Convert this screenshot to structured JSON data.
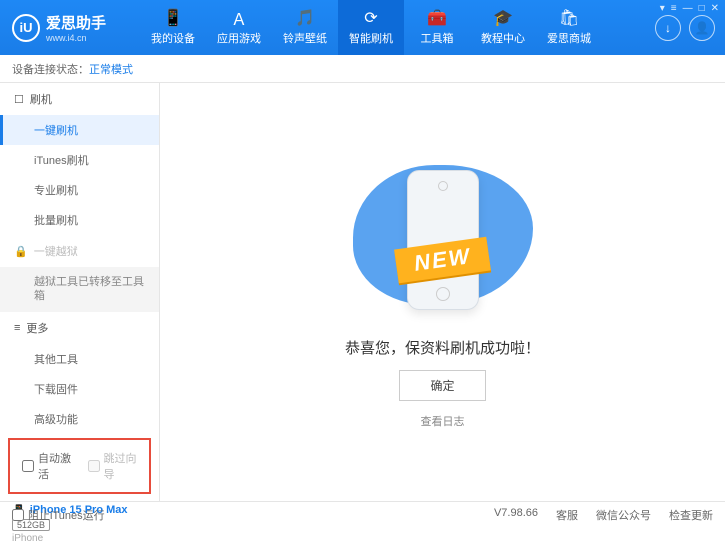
{
  "header": {
    "logo_text": "爱思助手",
    "logo_url": "www.i4.cn",
    "logo_badge": "iU",
    "nav": [
      {
        "label": "我的设备",
        "icon": "📱"
      },
      {
        "label": "应用游戏",
        "icon": "Ａ"
      },
      {
        "label": "铃声壁纸",
        "icon": "🎵"
      },
      {
        "label": "智能刷机",
        "icon": "⟳",
        "active": true
      },
      {
        "label": "工具箱",
        "icon": "🧰"
      },
      {
        "label": "教程中心",
        "icon": "🎓"
      },
      {
        "label": "爱思商城",
        "icon": "🛍"
      }
    ],
    "download_icon": "↓",
    "user_icon": "👤",
    "win_controls": [
      "▾",
      "≡",
      "—",
      "□",
      "✕"
    ]
  },
  "status": {
    "label": "设备连接状态：",
    "mode": "正常模式"
  },
  "sidebar": {
    "flash": {
      "label": "刷机",
      "icon": "☐"
    },
    "flash_items": [
      "一键刷机",
      "iTunes刷机",
      "专业刷机",
      "批量刷机"
    ],
    "jailbreak": {
      "label": "一键越狱",
      "icon": "🔒"
    },
    "jailbreak_transfer": "越狱工具已转移至工具箱",
    "more": {
      "label": "更多",
      "icon": "≡"
    },
    "more_items": [
      "其他工具",
      "下载固件",
      "高级功能"
    ],
    "checkboxes": {
      "auto_activate": "自动激活",
      "skip_guide": "跳过向导"
    },
    "device": {
      "name": "iPhone 15 Pro Max",
      "storage": "512GB",
      "type": "iPhone",
      "icon": "📱"
    }
  },
  "main": {
    "ribbon": "NEW",
    "success_text": "恭喜您，保资料刷机成功啦！",
    "confirm_btn": "确定",
    "log_link": "查看日志"
  },
  "footer": {
    "block_itunes": "阻止iTunes运行",
    "version": "V7.98.66",
    "links": [
      "客服",
      "微信公众号",
      "检查更新"
    ]
  }
}
